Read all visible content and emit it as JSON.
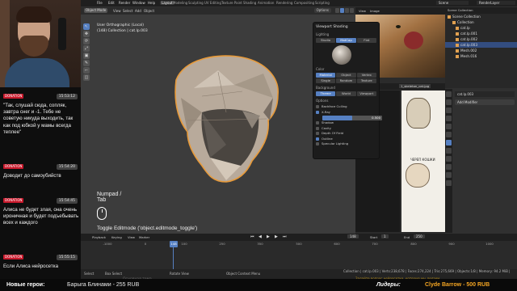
{
  "chat": {
    "messages": [
      {
        "badge": "DONATION",
        "time": "15:53:12",
        "text": "\"Так, слушай сюда, сопляк, завтра снег и -1. Тебе не советую никуда выходить, так как под юбкой у мамы всегда теплее\""
      },
      {
        "badge": "DONATION",
        "time": "15:54:20",
        "text": "Доводит до самоубийств"
      },
      {
        "badge": "DONATION",
        "time": "15:54:45",
        "text": "Алиса не будет злая, она очень ироничная и будет подъебывать всех и каждого"
      },
      {
        "badge": "DONATION",
        "time": "15:55:15",
        "text": "Если Алиса нейросетка"
      }
    ]
  },
  "ticker": {
    "new_heroes_label": "Новые герои:",
    "new_donor": "Барыга Блинами - 255 RUB",
    "leaders_label": "Лидеры:",
    "leader": "Clyde Barrow - 500 RUB"
  },
  "blender": {
    "menus": [
      "File",
      "Edit",
      "Render",
      "Window",
      "Help"
    ],
    "workspaces": [
      "Layout",
      "Modeling",
      "Sculpting",
      "UV Editing",
      "Texture Paint",
      "Shading",
      "Animation",
      "Rendering",
      "Compositing",
      "Scripting"
    ],
    "active_workspace": "Layout",
    "scene": "Scene",
    "view_layer": "RenderLayer",
    "viewport": {
      "mode": "Object Mode",
      "header_items": [
        "View",
        "Select",
        "Add",
        "Object"
      ],
      "options_label": "Options",
      "info_line1": "User Orthographic (Local)",
      "info_line2": "(148) Collection | cat.lp.003",
      "numpad_line1": "Numpad /",
      "numpad_line2": "Tab",
      "hint": "Toggle Editmode ('object.editmode_toggle')",
      "tools": [
        "↖",
        "✥",
        "⟳",
        "⤢",
        "▣",
        "✎",
        "⌐",
        "◫"
      ]
    },
    "shading_popover": {
      "title": "Viewport Shading",
      "lighting_label": "Lighting",
      "lighting_options": [
        "Studio",
        "MatCap",
        "Flat"
      ],
      "lighting_active": "MatCap",
      "color_label": "Color",
      "color_options_row1": [
        "Material",
        "Object",
        "Vertex"
      ],
      "color_options_row2": [
        "Single",
        "Random",
        "Texture"
      ],
      "color_active": "Material",
      "background_label": "Background",
      "background_options": [
        "Theme",
        "World",
        "Viewport"
      ],
      "background_active": "Theme",
      "options_label": "Options",
      "checkboxes": [
        {
          "label": "Backface Culling",
          "on": false
        },
        {
          "label": "X-Ray",
          "on": true
        },
        {
          "label": "Shadow",
          "on": false
        },
        {
          "label": "Cavity",
          "on": false
        },
        {
          "label": "Depth Of Field",
          "on": false
        },
        {
          "label": "Outline",
          "on": true
        },
        {
          "label": "Specular Lighting",
          "on": false
        }
      ],
      "xray_value": "0.500",
      "xray_fraction": 0.5
    },
    "image_editor": {
      "filename": "1_skeleton_cat.jpg",
      "view_items": [
        "View",
        "Image"
      ],
      "caption": "ЧЕРЕП КОШКИ",
      "ref_file": "cat_ref.jpg"
    },
    "outliner": {
      "header": "Scene Collection",
      "rows": [
        {
          "name": "Scene Collection",
          "level": 0,
          "sel": false
        },
        {
          "name": "Collection",
          "level": 1,
          "sel": false
        },
        {
          "name": "cat.lp",
          "level": 2,
          "sel": false
        },
        {
          "name": "cat.lp.001",
          "level": 2,
          "sel": false
        },
        {
          "name": "cat.lp.002",
          "level": 2,
          "sel": false
        },
        {
          "name": "cat.lp.003",
          "level": 2,
          "sel": true
        },
        {
          "name": "Mesh.002",
          "level": 2,
          "sel": false
        },
        {
          "name": "Mesh.016",
          "level": 2,
          "sel": false
        }
      ]
    },
    "properties": {
      "object_name": "cat.lp.003",
      "add_modifier": "Add Modifier"
    },
    "timeline": {
      "header_items": [
        "Playback",
        "Keying",
        "View",
        "Marker"
      ],
      "current_frame": "148",
      "start_label": "Start",
      "start_value": "1",
      "end_label": "End",
      "end_value": "250",
      "ticks": [
        "-1000",
        "0",
        "100",
        "250",
        "350",
        "500",
        "600",
        "700",
        "800",
        "900",
        "1000"
      ],
      "ticks_pos_pct": [
        0,
        0,
        0,
        0,
        0,
        0,
        0,
        0,
        0,
        0,
        0
      ],
      "cursor_label": "148"
    },
    "statusbar": {
      "select": "Select",
      "box_select": "Box Select",
      "rotate": "Rotate View",
      "context": "Object Context Menu",
      "stats": "Collection | cat.lp.003 | Verts:238,678 | Faces:274,224 | Tris:275,669 | Objects:1/8 | Memory: 94.2 MiB | 2.91.0",
      "subtitle": "Основная тема",
      "promo": "Задайте вопрос нейросетке, которую мы делаем"
    }
  }
}
